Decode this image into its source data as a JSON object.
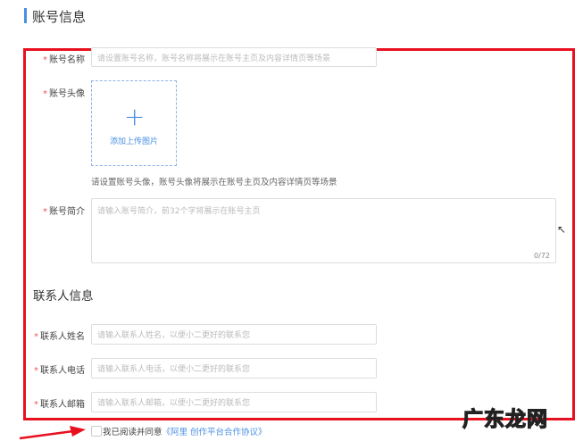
{
  "section1": {
    "title": "账号信息"
  },
  "account_name": {
    "label": "账号名称",
    "placeholder": "请设置账号名称，账号名称将展示在账号主页及内容详情页等场景"
  },
  "avatar": {
    "label": "账号头像",
    "upload_label": "添加上传图片",
    "hint": "请设置账号头像，账号头像将展示在账号主页及内容详情页等场景"
  },
  "intro": {
    "label": "账号简介",
    "placeholder": "请输入账号简介，前32个字将展示在账号主页",
    "counter": "0/72"
  },
  "section2": {
    "title": "联系人信息"
  },
  "contact": [
    {
      "label": "联系人姓名",
      "placeholder": "请输入联系人姓名，以便小二更好的联系您"
    },
    {
      "label": "联系人电话",
      "placeholder": "请输入联系人电话，以便小二更好的联系您"
    },
    {
      "label": "联系人邮箱",
      "placeholder": "请输入联系人邮箱，以便小二更好的联系您"
    }
  ],
  "agreement": {
    "text": "我已阅读并同意",
    "link": "《阿里 创作平台合作协议》"
  },
  "watermark": "广东龙网",
  "colors": {
    "accent": "#4a90e2",
    "highlight": "#e8101e"
  }
}
